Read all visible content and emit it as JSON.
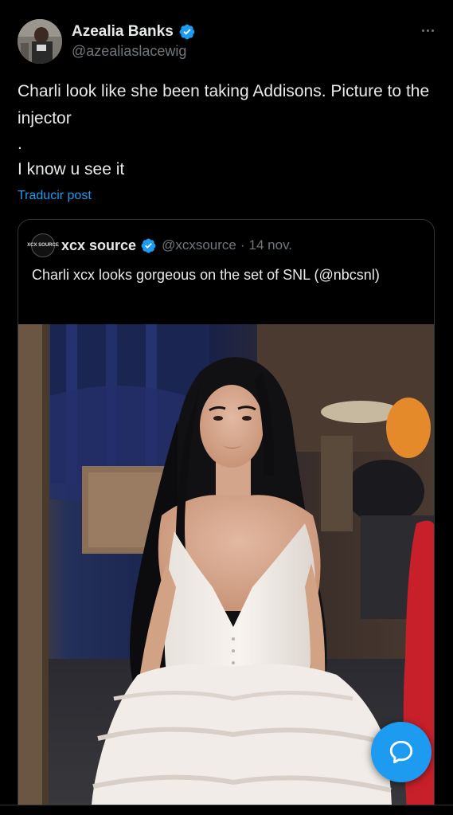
{
  "author": {
    "display_name": "Azealia Banks",
    "handle": "@azealiaslacewig",
    "verified": true
  },
  "tweet": {
    "line1": "Charli look like she been taking Addisons. Picture to the injector",
    "line2": ".",
    "line3": "I know u see it",
    "translate_label": "Traducir post"
  },
  "quote": {
    "avatar_text": "XCX SOURCE",
    "display_name": "xcx source",
    "handle": "@xcxsource",
    "separator": "·",
    "time": "14 nov.",
    "text": "Charli xcx looks gorgeous on the set of SNL (@nbcsnl)"
  },
  "colors": {
    "background": "#000000",
    "text": "#e7e9ea",
    "secondary": "#71767b",
    "accent": "#1d9bf0",
    "border": "#2f3336"
  },
  "icons": {
    "more": "more-horizontal-icon",
    "verified": "verified-badge-icon",
    "fab": "reply-compose-icon"
  }
}
